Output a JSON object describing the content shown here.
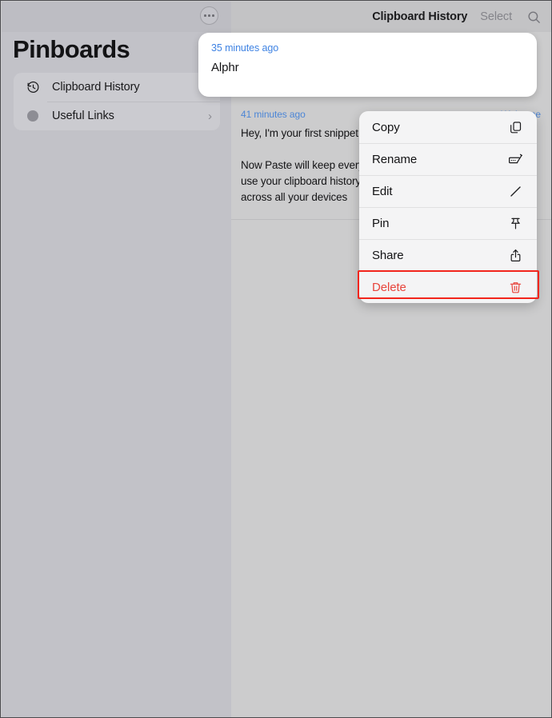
{
  "sidebar": {
    "more_button": "more-options",
    "title": "Pinboards",
    "items": [
      {
        "label": "Clipboard History",
        "icon": "clock-arrow-icon",
        "chevron": ""
      },
      {
        "label": "Useful Links",
        "icon": "circle-dot-icon",
        "chevron": "›"
      }
    ]
  },
  "content": {
    "title": "Clipboard History",
    "select_label": "Select",
    "search_icon": "search-icon",
    "snippets": [
      {
        "time": "41 minutes ago",
        "title": "Welcome",
        "body": "Hey, I'm your first snippet\n\nNow Paste will keep everything you\nuse your clipboard history safe\nacross all your devices"
      }
    ]
  },
  "card_popover": {
    "time": "35 minutes ago",
    "value": "Alphr"
  },
  "context_menu": {
    "items": [
      {
        "label": "Copy",
        "icon": "copy-icon",
        "destructive": false
      },
      {
        "label": "Rename",
        "icon": "rename-icon",
        "destructive": false
      },
      {
        "label": "Edit",
        "icon": "pencil-icon",
        "destructive": false
      },
      {
        "label": "Pin",
        "icon": "pin-icon",
        "destructive": false
      },
      {
        "label": "Share",
        "icon": "share-icon",
        "destructive": false
      },
      {
        "label": "Delete",
        "icon": "trash-icon",
        "destructive": true
      }
    ]
  },
  "colors": {
    "accent_blue": "#3f83e3",
    "destructive_red": "#e8453c",
    "annotation_red": "#f2251c",
    "sidebar_bg": "#c2c2c8",
    "content_bg": "#cccccd",
    "menu_bg": "#f4f4f5"
  }
}
